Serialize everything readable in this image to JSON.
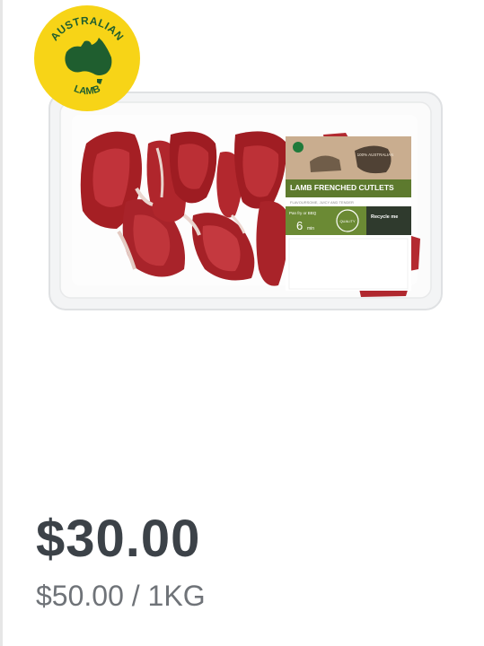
{
  "product": {
    "badge": {
      "line1": "AUSTRALIAN",
      "line2": "LAMB"
    },
    "label": {
      "stamp": "100% AUSTRALIAN",
      "title": "LAMB FRENCHED CUTLETS",
      "subtitle": "FLAVOURSOME, JUICY AND TENDER",
      "cook_label": "Pan fry or BBQ",
      "cook_time": "6",
      "cook_unit": "min",
      "quality": "QUALITY",
      "recycle": "Recycle me"
    }
  },
  "pricing": {
    "price": "$30.00",
    "unit_price": "$50.00 / 1KG"
  }
}
